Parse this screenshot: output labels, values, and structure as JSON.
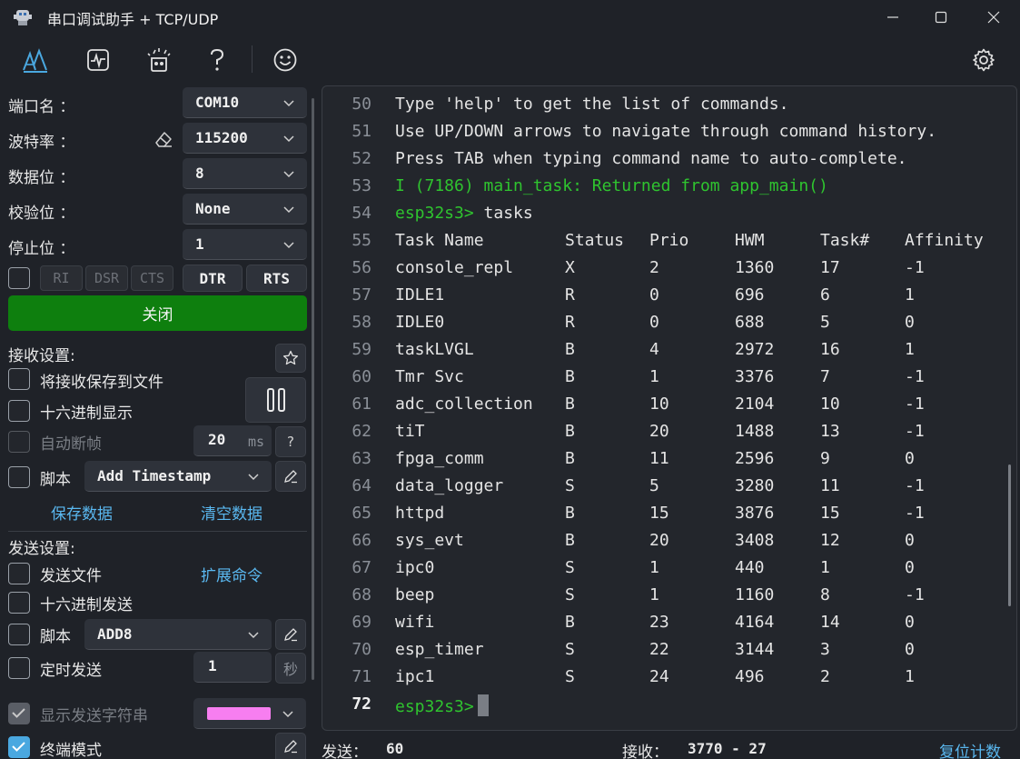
{
  "window": {
    "title": "串口调试助手 + TCP/UDP",
    "controls": [
      "minimize",
      "maximize",
      "close"
    ]
  },
  "toolbar": {
    "items": [
      "serial-icon",
      "waveform-icon",
      "tools-icon",
      "help-icon",
      "smiley-icon"
    ],
    "settings": "gear-icon"
  },
  "serial": {
    "port_label": "端口名 ：",
    "port_value": "COM10",
    "baud_label": "波特率 ：",
    "baud_value": "115200",
    "databits_label": "数据位 ：",
    "databits_value": "8",
    "parity_label": "校验位 ：",
    "parity_value": "None",
    "stopbits_label": "停止位 ：",
    "stopbits_value": "1",
    "pins": {
      "ri": "RI",
      "dsr": "DSR",
      "cts": "CTS",
      "dtr": "DTR",
      "rts": "RTS"
    },
    "open_button": "关闭",
    "open_button_color": "#0e7f0e"
  },
  "receive": {
    "title": "接收设置:",
    "save_to_file": "将接收保存到文件",
    "hex_display": "十六进制显示",
    "auto_frame": "自动断帧",
    "auto_frame_value": "20",
    "auto_frame_unit": "ms",
    "script_label": "脚本",
    "script_value": "Add Timestamp",
    "save_data": "保存数据",
    "clear_data": "清空数据"
  },
  "send": {
    "title": "发送设置:",
    "send_file": "发送文件",
    "extend_cmd": "扩展命令",
    "hex_send": "十六进制发送",
    "script_label": "脚本",
    "script_value": "ADD8",
    "timed_send": "定时发送",
    "timed_value": "1",
    "timed_unit": "秒",
    "show_send": "显示发送字符串",
    "show_send_color": "#f77ef0",
    "terminal_mode": "终端模式"
  },
  "terminal": {
    "lines": [
      {
        "n": "50",
        "text": "Type 'help' to get the list of commands."
      },
      {
        "n": "51",
        "text": "Use UP/DOWN arrows to navigate through command history."
      },
      {
        "n": "52",
        "text": "Press TAB when typing command name to auto-complete."
      },
      {
        "n": "53",
        "text": "I (7186) main_task: Returned from app_main()",
        "green": true
      },
      {
        "n": "54",
        "prompt": "esp32s3>",
        "text": " tasks"
      }
    ],
    "table_header": {
      "n": "55",
      "cols": [
        "Task Name",
        "Status",
        "Prio",
        "HWM",
        "Task#",
        "Affinity"
      ]
    },
    "rows": [
      {
        "n": "56",
        "cols": [
          "console_repl",
          "X",
          "2",
          "1360",
          "17",
          "-1"
        ]
      },
      {
        "n": "57",
        "cols": [
          "IDLE1",
          "R",
          "0",
          "696",
          "6",
          "1"
        ]
      },
      {
        "n": "58",
        "cols": [
          "IDLE0",
          "R",
          "0",
          "688",
          "5",
          "0"
        ]
      },
      {
        "n": "59",
        "cols": [
          "taskLVGL",
          "B",
          "4",
          "2972",
          "16",
          "1"
        ]
      },
      {
        "n": "60",
        "cols": [
          "Tmr Svc",
          "B",
          "1",
          "3376",
          "7",
          "-1"
        ]
      },
      {
        "n": "61",
        "cols": [
          "adc_collection",
          "B",
          "10",
          "2104",
          "10",
          "-1"
        ]
      },
      {
        "n": "62",
        "cols": [
          "tiT",
          "B",
          "20",
          "1488",
          "13",
          "-1"
        ]
      },
      {
        "n": "63",
        "cols": [
          "fpga_comm",
          "B",
          "11",
          "2596",
          "9",
          "0"
        ]
      },
      {
        "n": "64",
        "cols": [
          "data_logger",
          "S",
          "5",
          "3280",
          "11",
          "-1"
        ]
      },
      {
        "n": "65",
        "cols": [
          "httpd",
          "B",
          "15",
          "3876",
          "15",
          "-1"
        ]
      },
      {
        "n": "66",
        "cols": [
          "sys_evt",
          "B",
          "20",
          "3408",
          "12",
          "0"
        ]
      },
      {
        "n": "67",
        "cols": [
          "ipc0",
          "S",
          "1",
          "440",
          "1",
          "0"
        ]
      },
      {
        "n": "68",
        "cols": [
          "beep",
          "S",
          "1",
          "1160",
          "8",
          "-1"
        ]
      },
      {
        "n": "69",
        "cols": [
          "wifi",
          "B",
          "23",
          "4164",
          "14",
          "0"
        ]
      },
      {
        "n": "70",
        "cols": [
          "esp_timer",
          "S",
          "22",
          "3144",
          "3",
          "0"
        ]
      },
      {
        "n": "71",
        "cols": [
          "ipc1",
          "S",
          "24",
          "496",
          "2",
          "1"
        ]
      }
    ],
    "current": {
      "n": "72",
      "prompt": "esp32s3>"
    }
  },
  "status": {
    "sent_label": "发送：",
    "sent_value": "60",
    "recv_label": "接收：",
    "recv_value": "3770  -  27",
    "reset": "复位计数"
  }
}
